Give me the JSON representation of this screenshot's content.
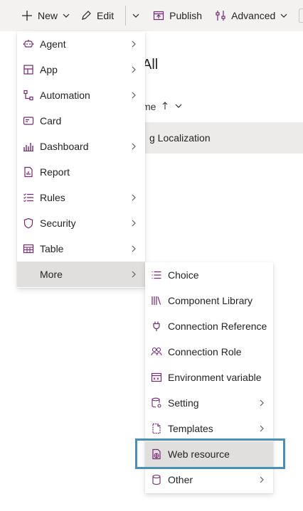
{
  "toolbar": {
    "new_label": "New",
    "edit_label": "Edit",
    "publish_label": "Publish",
    "advanced_label": "Advanced"
  },
  "background": {
    "view_title": "All",
    "column_header": "me",
    "row_text": "g Localization"
  },
  "new_menu": {
    "items": [
      {
        "label": "Agent",
        "icon": "agent-icon",
        "submenu": true
      },
      {
        "label": "App",
        "icon": "app-icon",
        "submenu": true
      },
      {
        "label": "Automation",
        "icon": "automation-icon",
        "submenu": true
      },
      {
        "label": "Card",
        "icon": "card-icon",
        "submenu": false
      },
      {
        "label": "Dashboard",
        "icon": "dashboard-icon",
        "submenu": true
      },
      {
        "label": "Report",
        "icon": "report-icon",
        "submenu": false
      },
      {
        "label": "Rules",
        "icon": "rules-icon",
        "submenu": true
      },
      {
        "label": "Security",
        "icon": "shield-icon",
        "submenu": true
      },
      {
        "label": "Table",
        "icon": "table-icon",
        "submenu": true
      },
      {
        "label": "More",
        "icon": "",
        "submenu": true,
        "active": true
      }
    ]
  },
  "more_menu": {
    "items": [
      {
        "label": "Choice",
        "icon": "choice-icon",
        "submenu": false
      },
      {
        "label": "Component Library",
        "icon": "component-library-icon",
        "submenu": false
      },
      {
        "label": "Connection Reference",
        "icon": "connection-reference-icon",
        "submenu": false
      },
      {
        "label": "Connection Role",
        "icon": "connection-role-icon",
        "submenu": false
      },
      {
        "label": "Environment variable",
        "icon": "environment-variable-icon",
        "submenu": false
      },
      {
        "label": "Setting",
        "icon": "setting-icon",
        "submenu": true
      },
      {
        "label": "Templates",
        "icon": "templates-icon",
        "submenu": true
      },
      {
        "label": "Web resource",
        "icon": "web-resource-icon",
        "submenu": false,
        "highlighted": true
      },
      {
        "label": "Other",
        "icon": "other-icon",
        "submenu": true
      }
    ]
  },
  "colors": {
    "accent_purple": "#742774",
    "highlight_border": "#4a8fb5",
    "active_item_bg": "#e1dfdd",
    "toolbar_bg": "#f3f2f1"
  }
}
